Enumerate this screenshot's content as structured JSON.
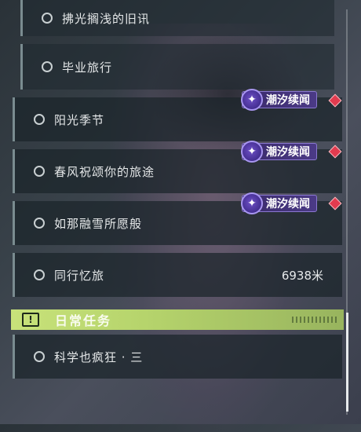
{
  "quests": [
    {
      "label": "拂光搁浅的旧讯"
    },
    {
      "label": "毕业旅行"
    },
    {
      "label": "阳光季节"
    },
    {
      "label": "春风祝颂你的旅途"
    },
    {
      "label": "如那融雪所愿般"
    },
    {
      "label": "同行忆旅",
      "distance": "6938米"
    }
  ],
  "badge": {
    "label": "潮汐续闻",
    "icon": "tide-sparkle-icon"
  },
  "daily_section": {
    "title": "日常任务",
    "icon": "exclamation-icon"
  },
  "daily_quests": [
    {
      "label": "科学也疯狂 · 三"
    }
  ],
  "colors": {
    "accent_green": "#c8e27a",
    "badge_purple": "#4b3a86",
    "alert_red": "#e23b4f"
  }
}
